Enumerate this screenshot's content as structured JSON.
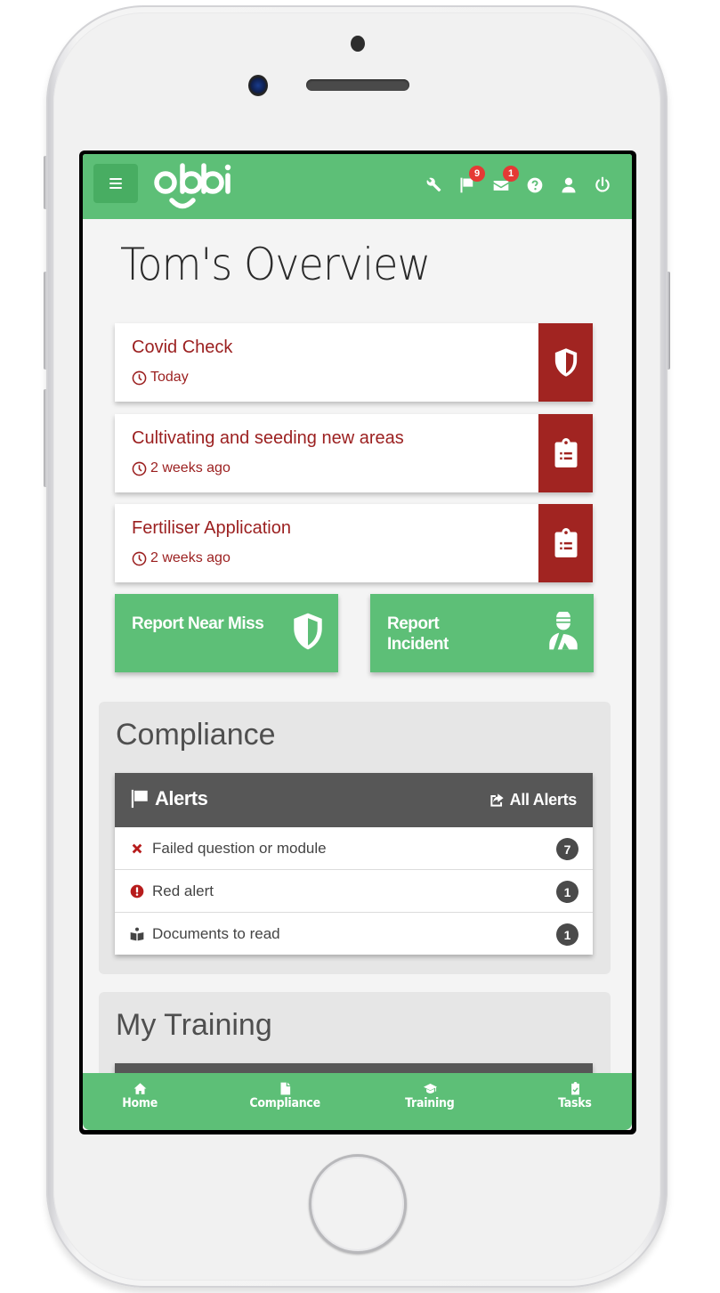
{
  "device": {
    "type": "phone-mockup"
  },
  "header": {
    "logo_text": "obbi",
    "menu_icon": "hamburger-icon",
    "icons": [
      {
        "name": "wrench-icon",
        "label": "Tools",
        "badge": null
      },
      {
        "name": "flag-icon",
        "label": "Alerts",
        "badge": "9"
      },
      {
        "name": "envelope-icon",
        "label": "Messages",
        "badge": "1"
      },
      {
        "name": "question-circle-icon",
        "label": "Help",
        "badge": null
      },
      {
        "name": "user-icon",
        "label": "Profile",
        "badge": null
      },
      {
        "name": "power-icon",
        "label": "Log out",
        "badge": null
      }
    ],
    "colors": {
      "bar": "#5dbf77",
      "badge": "#e53935"
    }
  },
  "page": {
    "title": "Tom's Overview"
  },
  "tasks": [
    {
      "title": "Covid Check",
      "time": "Today",
      "icon": "shield-icon"
    },
    {
      "title": "Cultivating and seeding new areas",
      "time": "2 weeks ago",
      "icon": "clipboard-list-icon"
    },
    {
      "title": "Fertiliser Application",
      "time": "2 weeks ago",
      "icon": "clipboard-list-icon"
    }
  ],
  "task_colors": {
    "text": "#9b1f1f",
    "icon_bg": "#a12421"
  },
  "quick_actions": [
    {
      "label": "Report Near Miss",
      "icon": "shield-icon"
    },
    {
      "label": "Report Incident",
      "icon": "injured-person-icon"
    }
  ],
  "compliance": {
    "title": "Compliance",
    "alerts": {
      "title": "Alerts",
      "link_label": "All Alerts",
      "rows": [
        {
          "label": "Failed question or module",
          "count": "7",
          "icon": "times-icon",
          "icon_color": "#b71c1c"
        },
        {
          "label": "Red alert",
          "count": "1",
          "icon": "exclamation-circle-icon",
          "icon_color": "#b71c1c"
        },
        {
          "label": "Documents to read",
          "count": "1",
          "icon": "book-reader-icon",
          "icon_color": "#444444"
        }
      ]
    }
  },
  "training": {
    "title": "My Training"
  },
  "bottom_nav": [
    {
      "label": "Home",
      "icon": "home-icon"
    },
    {
      "label": "Compliance",
      "icon": "file-icon"
    },
    {
      "label": "Training",
      "icon": "graduation-cap-icon"
    },
    {
      "label": "Tasks",
      "icon": "clipboard-check-icon"
    }
  ]
}
